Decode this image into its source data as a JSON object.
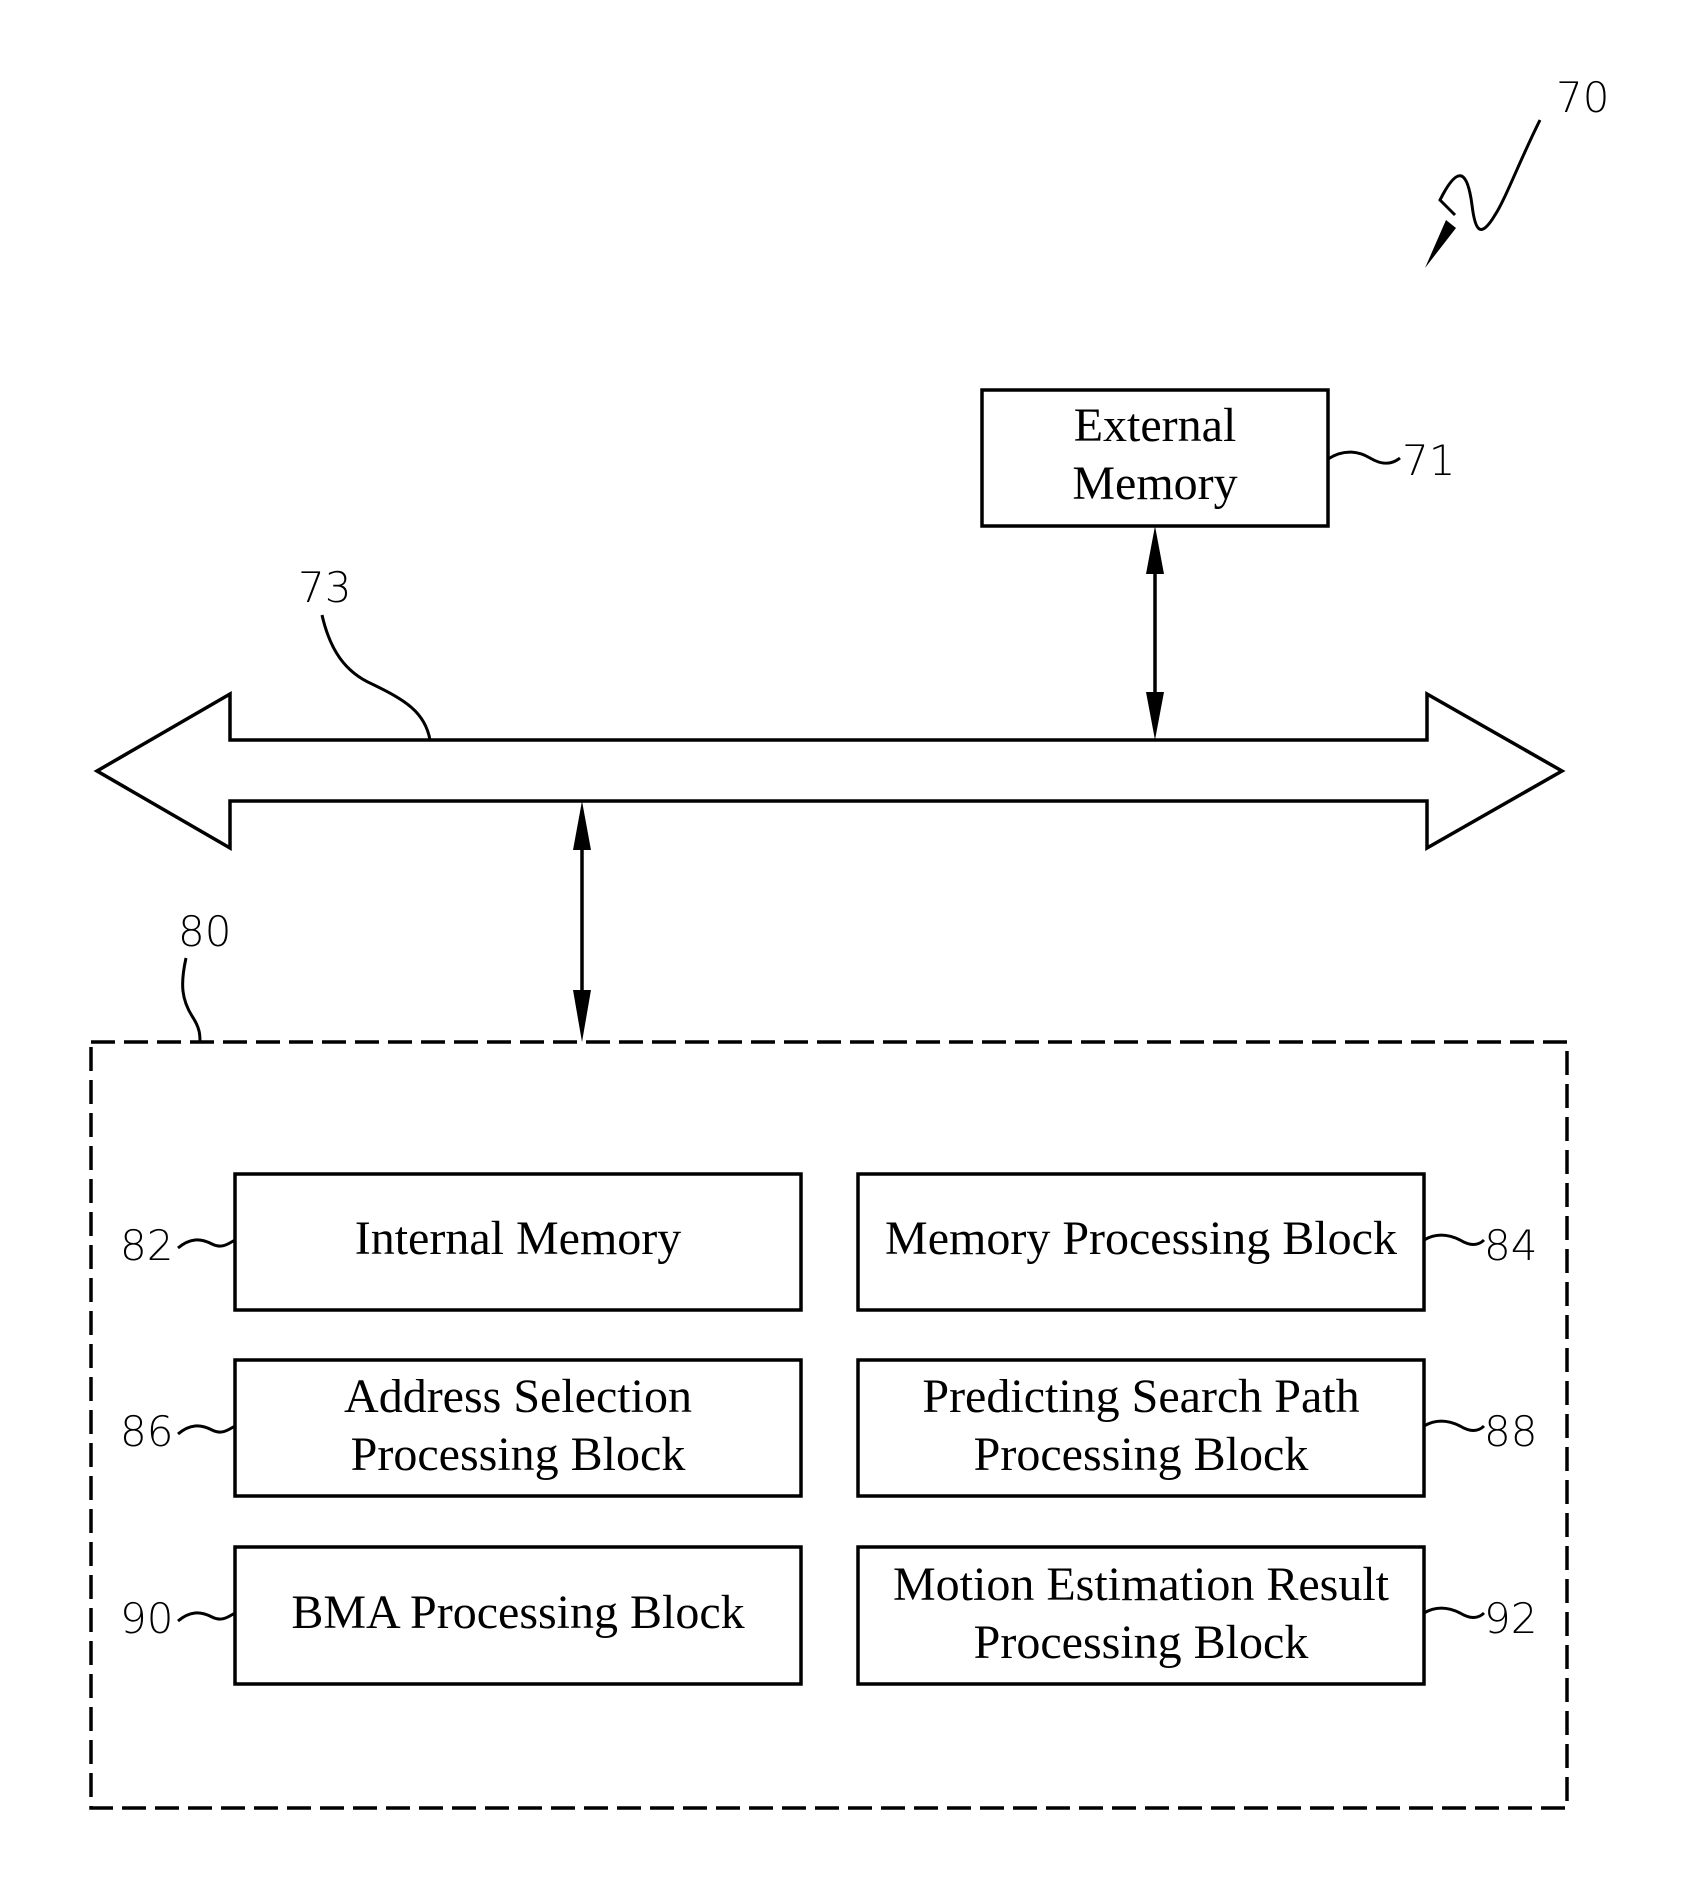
{
  "figure": {
    "reference": "70"
  },
  "external_memory": {
    "lines": [
      "External",
      "Memory"
    ],
    "reference": "71"
  },
  "bus": {
    "reference": "73"
  },
  "module": {
    "reference": "80",
    "blocks": [
      {
        "lines": [
          "Internal Memory"
        ],
        "reference": "82"
      },
      {
        "lines": [
          "Memory Processing Block"
        ],
        "reference": "84"
      },
      {
        "lines": [
          "Address Selection",
          "Processing Block"
        ],
        "reference": "86"
      },
      {
        "lines": [
          "Predicting Search Path",
          "Processing Block"
        ],
        "reference": "88"
      },
      {
        "lines": [
          "BMA Processing Block"
        ],
        "reference": "90"
      },
      {
        "lines": [
          "Motion Estimation Result",
          "Processing Block"
        ],
        "reference": "92"
      }
    ]
  }
}
